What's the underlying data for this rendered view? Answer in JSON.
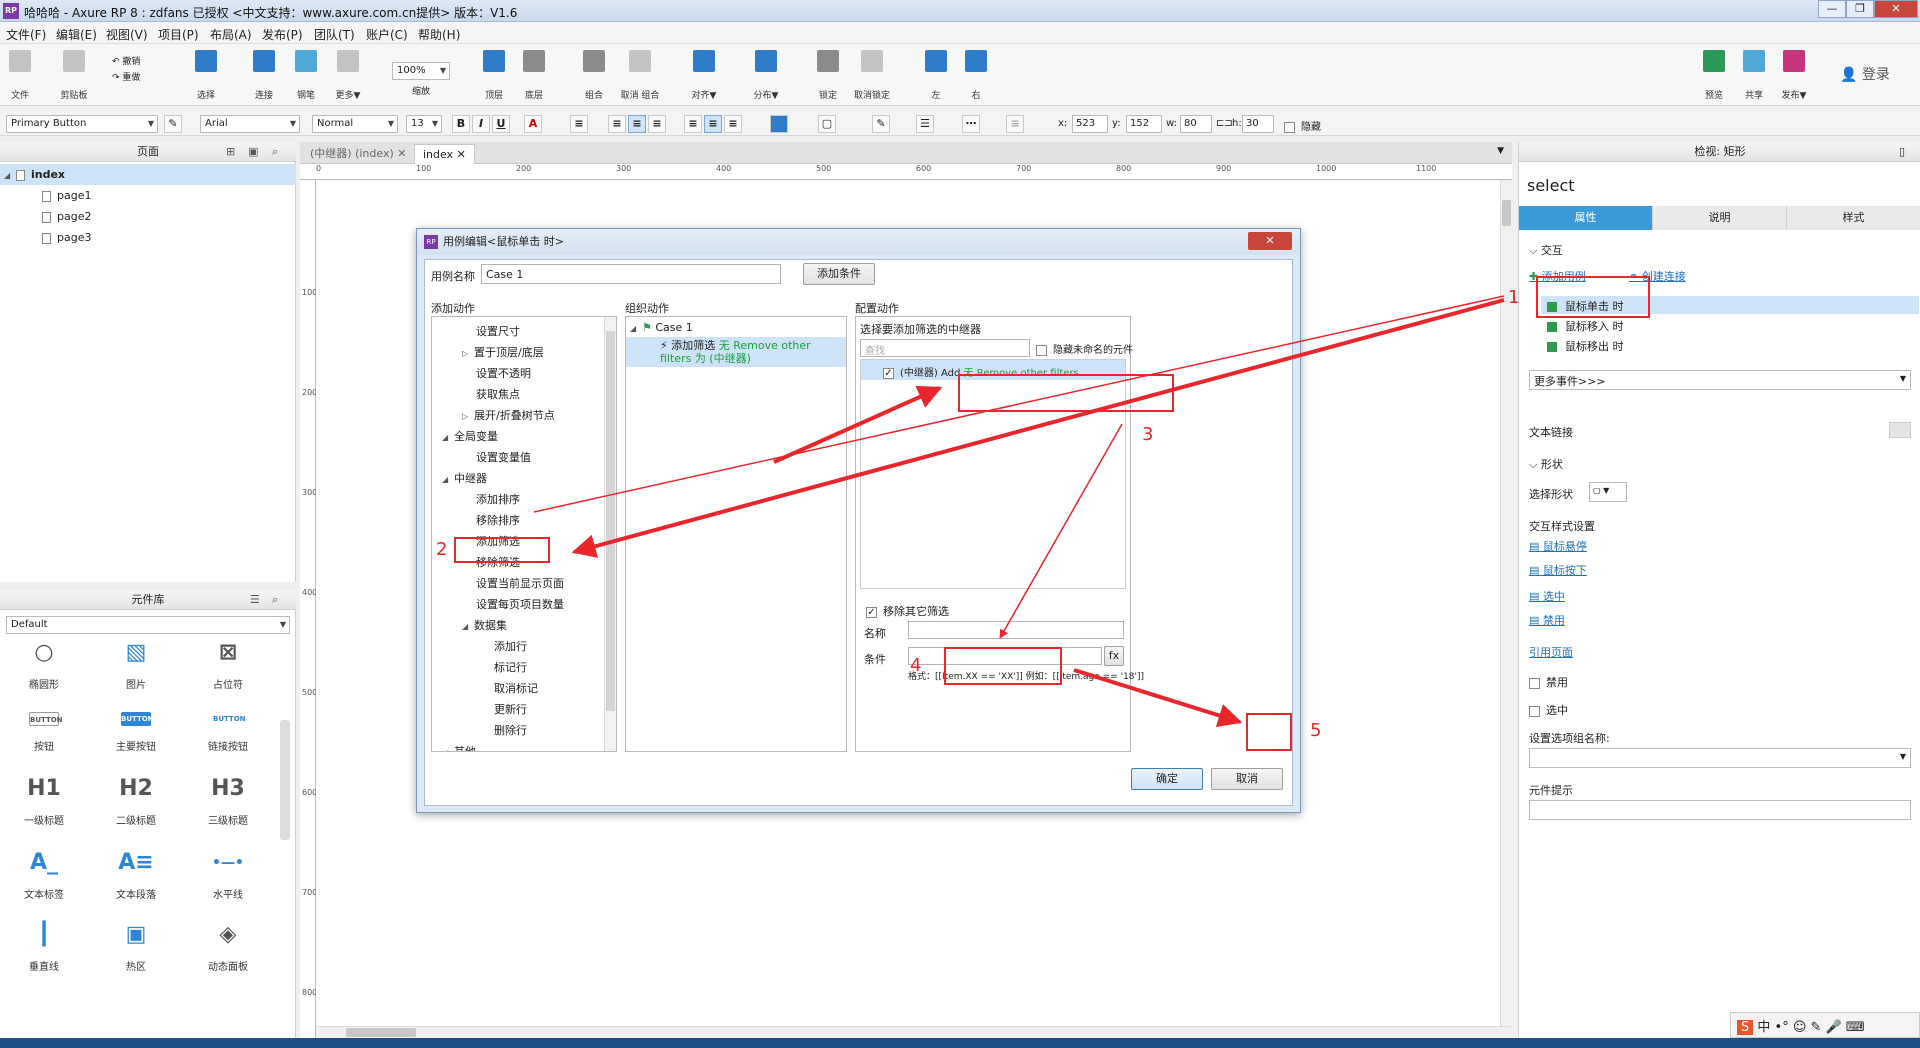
{
  "window": {
    "title": "哈哈哈 - Axure RP 8 : zdfans 已授权    <中文支持：www.axure.com.cn提供> 版本：V1.6",
    "logo": "RP"
  },
  "menu": [
    "文件(F)",
    "编辑(E)",
    "视图(V)",
    "项目(P)",
    "布局(A)",
    "发布(P)",
    "团队(T)",
    "账户(C)",
    "帮助(H)"
  ],
  "toolbar": {
    "file": "文件",
    "clipboard": "剪贴板",
    "undo": "撤销",
    "redo": "重做",
    "select": "选择",
    "connect": "连接",
    "pen": "钢笔",
    "more": "更多▼",
    "zoom_value": "100%",
    "zoom_label": "缩放",
    "top": "顶层",
    "bottom": "底层",
    "group": "组合",
    "ungroup": "取消 组合",
    "align": "对齐▼",
    "distribute": "分布▼",
    "lock": "锁定",
    "unlock": "取消锁定",
    "left": "左",
    "right": "右",
    "preview": "预览",
    "share": "共享",
    "publish": "发布▼",
    "login": "登录"
  },
  "formatbar": {
    "style": "Primary Button",
    "font": "Arial",
    "weight": "Normal",
    "size": "13",
    "x_label": "x:",
    "x": "523",
    "y_label": "y:",
    "y": "152",
    "w_label": "w:",
    "w": "80",
    "h_label": "h:",
    "h": "30",
    "hide": "隐藏"
  },
  "pages": {
    "header": "页面",
    "items": [
      {
        "label": "index",
        "selected": true
      },
      {
        "label": "page1"
      },
      {
        "label": "page2"
      },
      {
        "label": "page3"
      }
    ]
  },
  "widgets": {
    "header": "元件库",
    "library": "Default",
    "items": [
      {
        "icon": "○",
        "label": "椭圆形"
      },
      {
        "icon": "▧",
        "label": "图片"
      },
      {
        "icon": "⊠",
        "label": "占位符"
      },
      {
        "icon": "BUTTON",
        "label": "按钮"
      },
      {
        "icon": "BUTTON",
        "label": "主要按钮"
      },
      {
        "icon": "BUTTON",
        "label": "链接按钮"
      },
      {
        "icon": "H1",
        "label": "一级标题"
      },
      {
        "icon": "H2",
        "label": "二级标题"
      },
      {
        "icon": "H3",
        "label": "三级标题"
      },
      {
        "icon": "A_",
        "label": "文本标签"
      },
      {
        "icon": "A≡",
        "label": "文本段落"
      },
      {
        "icon": "•—•",
        "label": "水平线"
      },
      {
        "icon": "┃",
        "label": "垂直线"
      },
      {
        "icon": "▣",
        "label": "热区"
      },
      {
        "icon": "◈",
        "label": "动态面板"
      }
    ]
  },
  "canvas": {
    "tabs": [
      {
        "label": "(中继器) (index)"
      },
      {
        "label": "index",
        "active": true
      }
    ],
    "ruler_h": [
      "0",
      "100",
      "200",
      "300",
      "400",
      "500",
      "600",
      "700",
      "800",
      "900",
      "1000",
      "1100"
    ],
    "ruler_v": [
      "100",
      "200",
      "300",
      "400",
      "500",
      "600",
      "700",
      "800"
    ]
  },
  "dialog": {
    "title": "用例编辑<鼠标单击 时>",
    "case_name_label": "用例名称",
    "case_name_value": "Case 1",
    "add_condition": "添加条件",
    "add_action_header": "添加动作",
    "organize_header": "组织动作",
    "configure_header": "配置动作",
    "actions_tree": [
      {
        "label": "设置尺寸",
        "level": 2
      },
      {
        "label": "置于顶层/底层",
        "level": 2,
        "collapsed": true
      },
      {
        "label": "设置不透明",
        "level": 2
      },
      {
        "label": "获取焦点",
        "level": 2
      },
      {
        "label": "展开/折叠树节点",
        "level": 2,
        "collapsed": true
      },
      {
        "label": "全局变量",
        "level": 1,
        "expanded": true
      },
      {
        "label": "设置变量值",
        "level": 2
      },
      {
        "label": "中继器",
        "level": 1,
        "expanded": true
      },
      {
        "label": "添加排序",
        "level": 2
      },
      {
        "label": "移除排序",
        "level": 2
      },
      {
        "label": "添加筛选",
        "level": 2
      },
      {
        "label": "移除筛选",
        "level": 2
      },
      {
        "label": "设置当前显示页面",
        "level": 2
      },
      {
        "label": "设置每页项目数量",
        "level": 2
      },
      {
        "label": "数据集",
        "level": 2,
        "expanded": true
      },
      {
        "label": "添加行",
        "level": 3
      },
      {
        "label": "标记行",
        "level": 3
      },
      {
        "label": "取消标记",
        "level": 3
      },
      {
        "label": "更新行",
        "level": 3
      },
      {
        "label": "删除行",
        "level": 3
      },
      {
        "label": "其他",
        "level": 1,
        "expanded": true
      }
    ],
    "organize_case": "Case 1",
    "organize_action": "添加筛选",
    "organize_action_detail": "无 Remove other filters 为 (中继器)",
    "select_repeater_label": "选择要添加筛选的中继器",
    "search_placeholder": "查找",
    "hide_unnamed": "隐藏未命名的元件",
    "repeater_item_prefix": "(中继器) Add",
    "repeater_item_detail": "无 Remove other filters",
    "remove_other_filters": "移除其它筛选",
    "name_label": "名称",
    "condition_label": "条件",
    "fx": "fx",
    "format_hint": "格式：[[Item.XX == 'XX']] 例如：[[Item.age == '18']]",
    "ok": "确定",
    "cancel": "取消"
  },
  "inspector": {
    "header": "检视: 矩形",
    "widget_name": "select",
    "tabs": [
      "属性",
      "说明",
      "样式"
    ],
    "interaction_section": "交互",
    "add_case": "添加用例",
    "create_link": "创建连接",
    "events": [
      "鼠标单击 时",
      "鼠标移入 时",
      "鼠标移出 时"
    ],
    "more_events": "更多事件>>>",
    "text_link": "文本链接",
    "shape_section": "形状",
    "select_shape": "选择形状",
    "interaction_styles": "交互样式设置",
    "style_links": [
      "鼠标悬停",
      "鼠标按下",
      "选中",
      "禁用"
    ],
    "reference_page": "引用页面",
    "disabled": "禁用",
    "selected": "选中",
    "option_group": "设置选项组名称:",
    "tooltip": "元件提示"
  },
  "annotations": [
    "1",
    "2",
    "3",
    "4",
    "5"
  ],
  "colors": {
    "accent": "#3b9ad9",
    "annotation": "#e8262b",
    "action_green": "#18a040"
  }
}
